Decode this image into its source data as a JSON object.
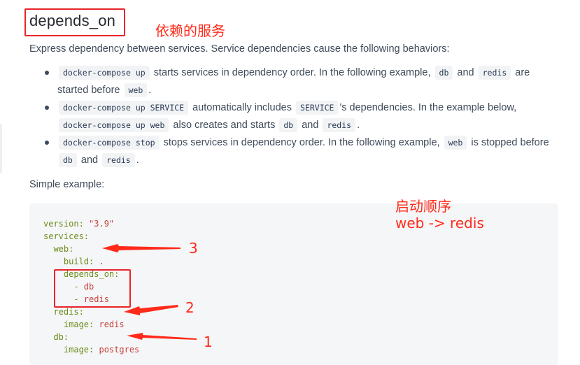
{
  "heading": "depends_on",
  "annotations": {
    "title_note": "依赖的服务",
    "order_label": "启动顺序",
    "order_value": "web -> redis",
    "num3": "3",
    "num2": "2",
    "num1": "1"
  },
  "intro": "Express dependency between services. Service dependencies cause the following behaviors:",
  "bullets": {
    "b1": {
      "code1": "docker-compose up",
      "t1": " starts services in dependency order. In the following example, ",
      "code2": "db",
      "t2": " and ",
      "code3": "redis",
      "t3": " are",
      "t4": "started before ",
      "code4": "web",
      "t5": "."
    },
    "b2": {
      "code1": "docker-compose up SERVICE",
      "t1": " automatically includes ",
      "code2": "SERVICE",
      "t2": "'s dependencies. In the example below,",
      "code3": "docker-compose up web",
      "t3": " also creates and starts ",
      "code4": "db",
      "t4": " and ",
      "code5": "redis",
      "t5": "."
    },
    "b3": {
      "code1": "docker-compose stop",
      "t1": " stops services in dependency order. In the following example, ",
      "code2": "web",
      "t2": " is stopped before",
      "code3": "db",
      "t3": " and ",
      "code4": "redis",
      "t4": "."
    }
  },
  "simple_label": "Simple example:",
  "code": {
    "l1k": "version: ",
    "l1v": "\"3.9\"",
    "l2k": "services:",
    "l3k": "  web:",
    "l4k": "    build: ",
    "l4v": ".",
    "l5k": "    depends_on:",
    "l6k": "      - ",
    "l6v": "db",
    "l7k": "      - ",
    "l7v": "redis",
    "l8k": "  redis:",
    "l9k": "    image: ",
    "l9v": "redis",
    "l10k": "  db:",
    "l11k": "    image: ",
    "l11v": "postgres"
  },
  "colors": {
    "annotation_red": "#ff2a1a",
    "code_key": "#6a8c1a",
    "code_value": "#c5413d"
  }
}
